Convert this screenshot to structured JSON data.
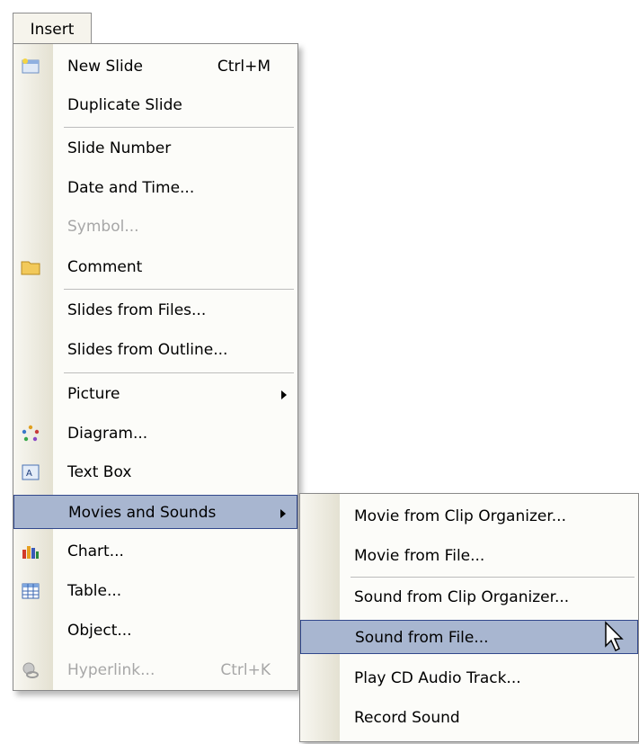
{
  "menubar": {
    "insert_label": "Insert"
  },
  "main_menu": {
    "items": [
      {
        "label": "New Slide",
        "shortcut": "Ctrl+M"
      },
      {
        "label": "Duplicate Slide"
      },
      {
        "label": "Slide Number"
      },
      {
        "label": "Date and Time..."
      },
      {
        "label": "Symbol..."
      },
      {
        "label": "Comment"
      },
      {
        "label": "Slides from Files..."
      },
      {
        "label": "Slides from Outline..."
      },
      {
        "label": "Picture"
      },
      {
        "label": "Diagram..."
      },
      {
        "label": "Text Box"
      },
      {
        "label": "Movies and Sounds"
      },
      {
        "label": "Chart..."
      },
      {
        "label": "Table..."
      },
      {
        "label": "Object..."
      },
      {
        "label": "Hyperlink...",
        "shortcut": "Ctrl+K"
      }
    ]
  },
  "sub_menu": {
    "items": [
      {
        "label": "Movie from Clip Organizer..."
      },
      {
        "label": "Movie from File..."
      },
      {
        "label": "Sound from Clip Organizer..."
      },
      {
        "label": "Sound from File..."
      },
      {
        "label": "Play CD Audio Track..."
      },
      {
        "label": "Record Sound"
      }
    ]
  },
  "colors": {
    "highlight": "#a8b6d0",
    "highlight_border": "#32488c",
    "disabled": "#a7a7a7"
  }
}
